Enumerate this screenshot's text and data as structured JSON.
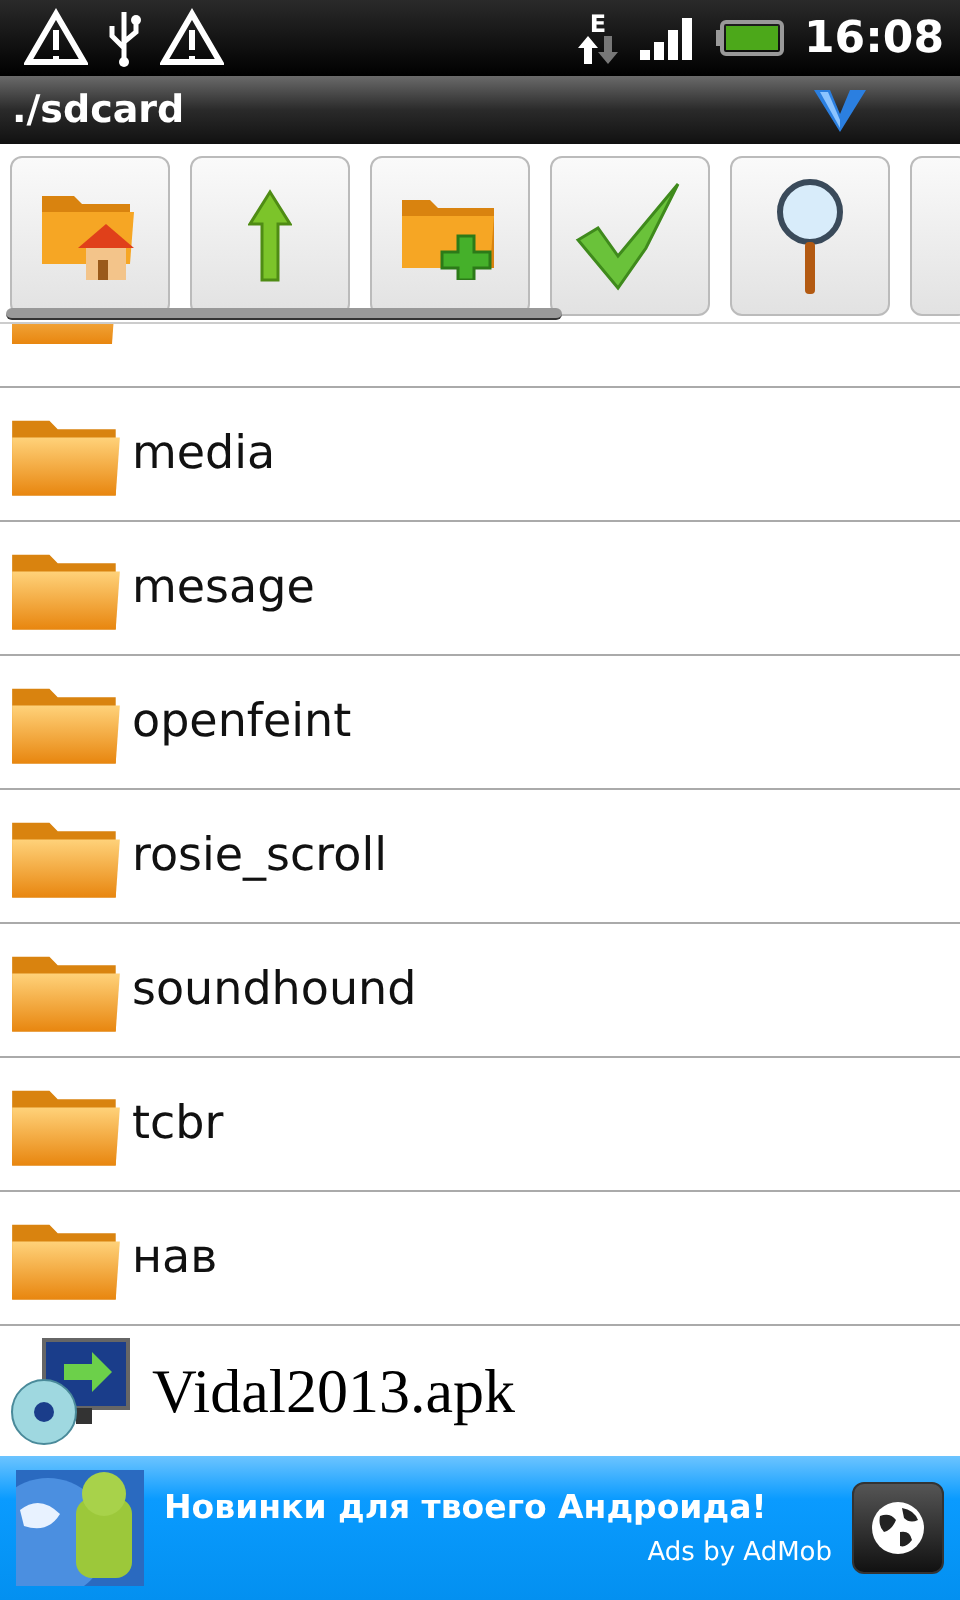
{
  "status_bar": {
    "network": "E",
    "time": "16:08"
  },
  "title_bar": {
    "path": "./sdcard"
  },
  "toolbar": [
    {
      "kind": "home"
    },
    {
      "kind": "up"
    },
    {
      "kind": "new-folder"
    },
    {
      "kind": "check"
    },
    {
      "kind": "search"
    },
    {
      "kind": "blank"
    }
  ],
  "files": [
    {
      "kind": "folder-partial"
    },
    {
      "kind": "folder",
      "name": "media"
    },
    {
      "kind": "folder",
      "name": "mesage"
    },
    {
      "kind": "folder",
      "name": "openfeint"
    },
    {
      "kind": "folder",
      "name": "rosie_scroll"
    },
    {
      "kind": "folder",
      "name": "soundhound"
    },
    {
      "kind": "folder",
      "name": "tcbr"
    },
    {
      "kind": "folder",
      "name": "нав"
    },
    {
      "kind": "apk",
      "name": "Vidal2013.apk"
    }
  ],
  "ad": {
    "headline": "Новинки для твоего Андроида!",
    "attribution": "Ads by AdMob"
  }
}
